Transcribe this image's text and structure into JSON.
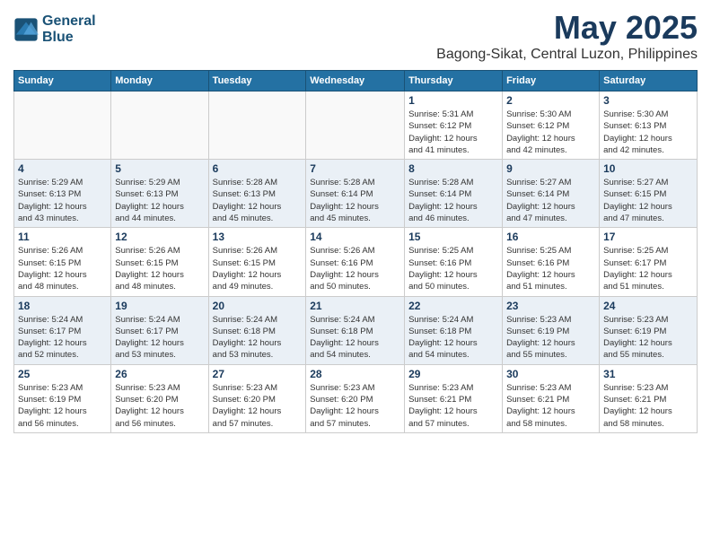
{
  "header": {
    "logo_line1": "General",
    "logo_line2": "Blue",
    "main_title": "May 2025",
    "subtitle": "Bagong-Sikat, Central Luzon, Philippines"
  },
  "weekdays": [
    "Sunday",
    "Monday",
    "Tuesday",
    "Wednesday",
    "Thursday",
    "Friday",
    "Saturday"
  ],
  "weeks": [
    [
      {
        "day": "",
        "info": "",
        "empty": true
      },
      {
        "day": "",
        "info": "",
        "empty": true
      },
      {
        "day": "",
        "info": "",
        "empty": true
      },
      {
        "day": "",
        "info": "",
        "empty": true
      },
      {
        "day": "1",
        "info": "Sunrise: 5:31 AM\nSunset: 6:12 PM\nDaylight: 12 hours\nand 41 minutes."
      },
      {
        "day": "2",
        "info": "Sunrise: 5:30 AM\nSunset: 6:12 PM\nDaylight: 12 hours\nand 42 minutes."
      },
      {
        "day": "3",
        "info": "Sunrise: 5:30 AM\nSunset: 6:13 PM\nDaylight: 12 hours\nand 42 minutes."
      }
    ],
    [
      {
        "day": "4",
        "info": "Sunrise: 5:29 AM\nSunset: 6:13 PM\nDaylight: 12 hours\nand 43 minutes."
      },
      {
        "day": "5",
        "info": "Sunrise: 5:29 AM\nSunset: 6:13 PM\nDaylight: 12 hours\nand 44 minutes."
      },
      {
        "day": "6",
        "info": "Sunrise: 5:28 AM\nSunset: 6:13 PM\nDaylight: 12 hours\nand 45 minutes."
      },
      {
        "day": "7",
        "info": "Sunrise: 5:28 AM\nSunset: 6:14 PM\nDaylight: 12 hours\nand 45 minutes."
      },
      {
        "day": "8",
        "info": "Sunrise: 5:28 AM\nSunset: 6:14 PM\nDaylight: 12 hours\nand 46 minutes."
      },
      {
        "day": "9",
        "info": "Sunrise: 5:27 AM\nSunset: 6:14 PM\nDaylight: 12 hours\nand 47 minutes."
      },
      {
        "day": "10",
        "info": "Sunrise: 5:27 AM\nSunset: 6:15 PM\nDaylight: 12 hours\nand 47 minutes."
      }
    ],
    [
      {
        "day": "11",
        "info": "Sunrise: 5:26 AM\nSunset: 6:15 PM\nDaylight: 12 hours\nand 48 minutes."
      },
      {
        "day": "12",
        "info": "Sunrise: 5:26 AM\nSunset: 6:15 PM\nDaylight: 12 hours\nand 48 minutes."
      },
      {
        "day": "13",
        "info": "Sunrise: 5:26 AM\nSunset: 6:15 PM\nDaylight: 12 hours\nand 49 minutes."
      },
      {
        "day": "14",
        "info": "Sunrise: 5:26 AM\nSunset: 6:16 PM\nDaylight: 12 hours\nand 50 minutes."
      },
      {
        "day": "15",
        "info": "Sunrise: 5:25 AM\nSunset: 6:16 PM\nDaylight: 12 hours\nand 50 minutes."
      },
      {
        "day": "16",
        "info": "Sunrise: 5:25 AM\nSunset: 6:16 PM\nDaylight: 12 hours\nand 51 minutes."
      },
      {
        "day": "17",
        "info": "Sunrise: 5:25 AM\nSunset: 6:17 PM\nDaylight: 12 hours\nand 51 minutes."
      }
    ],
    [
      {
        "day": "18",
        "info": "Sunrise: 5:24 AM\nSunset: 6:17 PM\nDaylight: 12 hours\nand 52 minutes."
      },
      {
        "day": "19",
        "info": "Sunrise: 5:24 AM\nSunset: 6:17 PM\nDaylight: 12 hours\nand 53 minutes."
      },
      {
        "day": "20",
        "info": "Sunrise: 5:24 AM\nSunset: 6:18 PM\nDaylight: 12 hours\nand 53 minutes."
      },
      {
        "day": "21",
        "info": "Sunrise: 5:24 AM\nSunset: 6:18 PM\nDaylight: 12 hours\nand 54 minutes."
      },
      {
        "day": "22",
        "info": "Sunrise: 5:24 AM\nSunset: 6:18 PM\nDaylight: 12 hours\nand 54 minutes."
      },
      {
        "day": "23",
        "info": "Sunrise: 5:23 AM\nSunset: 6:19 PM\nDaylight: 12 hours\nand 55 minutes."
      },
      {
        "day": "24",
        "info": "Sunrise: 5:23 AM\nSunset: 6:19 PM\nDaylight: 12 hours\nand 55 minutes."
      }
    ],
    [
      {
        "day": "25",
        "info": "Sunrise: 5:23 AM\nSunset: 6:19 PM\nDaylight: 12 hours\nand 56 minutes."
      },
      {
        "day": "26",
        "info": "Sunrise: 5:23 AM\nSunset: 6:20 PM\nDaylight: 12 hours\nand 56 minutes."
      },
      {
        "day": "27",
        "info": "Sunrise: 5:23 AM\nSunset: 6:20 PM\nDaylight: 12 hours\nand 57 minutes."
      },
      {
        "day": "28",
        "info": "Sunrise: 5:23 AM\nSunset: 6:20 PM\nDaylight: 12 hours\nand 57 minutes."
      },
      {
        "day": "29",
        "info": "Sunrise: 5:23 AM\nSunset: 6:21 PM\nDaylight: 12 hours\nand 57 minutes."
      },
      {
        "day": "30",
        "info": "Sunrise: 5:23 AM\nSunset: 6:21 PM\nDaylight: 12 hours\nand 58 minutes."
      },
      {
        "day": "31",
        "info": "Sunrise: 5:23 AM\nSunset: 6:21 PM\nDaylight: 12 hours\nand 58 minutes."
      }
    ]
  ]
}
